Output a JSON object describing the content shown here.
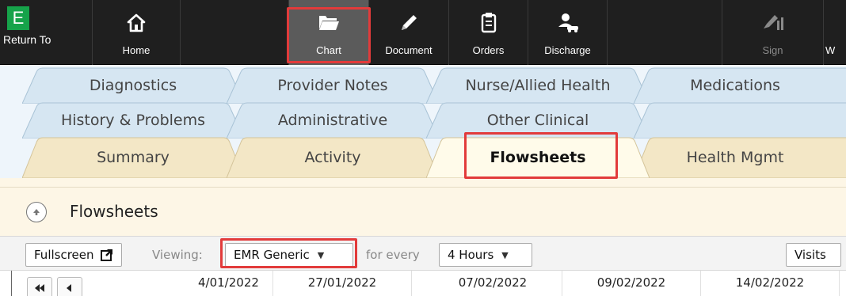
{
  "toolbar": {
    "return_badge": "E",
    "return_label": "Return To",
    "home_label": "Home",
    "chart_label": "Chart",
    "document_label": "Document",
    "orders_label": "Orders",
    "discharge_label": "Discharge",
    "sign_label": "Sign",
    "partial_label": "W"
  },
  "tabs": {
    "row1": [
      "Diagnostics",
      "Provider Notes",
      "Nurse/Allied Health",
      "Medications"
    ],
    "row2": [
      "History & Problems",
      "Administrative",
      "Other Clinical"
    ],
    "row3": [
      "Summary",
      "Activity",
      "Flowsheets",
      "Health Mgmt"
    ],
    "active": "Flowsheets"
  },
  "section": {
    "title": "Flowsheets"
  },
  "controls": {
    "fullscreen_label": "Fullscreen",
    "viewing_label": "Viewing:",
    "viewing_value": "EMR Generic",
    "for_every_label": "for every",
    "interval_value": "4 Hours",
    "visits_label": "Visits"
  },
  "dates": [
    "4/01/2022",
    "27/01/2022",
    "07/02/2022",
    "09/02/2022",
    "14/02/2022"
  ],
  "colors": {
    "toolbar_bg": "#1f1f1f",
    "highlight_red": "#e23b3b",
    "tab_blue": "#d6e6f2",
    "tab_beige": "#f3e7c6",
    "tab_active": "#fffbea",
    "brand_green": "#16a34a"
  }
}
